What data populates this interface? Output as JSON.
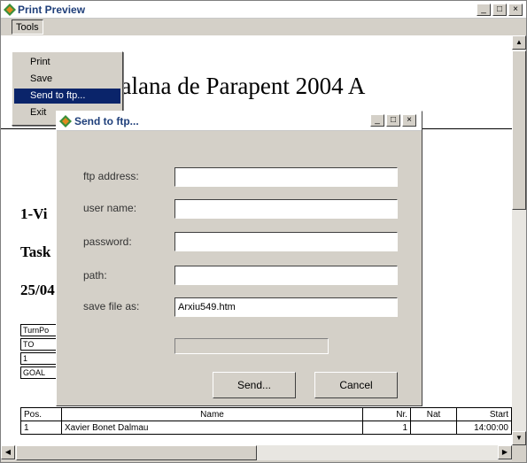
{
  "window": {
    "title": "Print Preview"
  },
  "menubar": {
    "tools_label": "Tools"
  },
  "tools_menu": {
    "items": [
      "Print",
      "Save",
      "Send to ftp...",
      "Exit"
    ],
    "selected": "Send to ftp..."
  },
  "page": {
    "title": "talana de Parapent 2004 A",
    "headings": [
      "1-Vi",
      "Task",
      "25/04"
    ],
    "boxes": [
      "TurnPo",
      "TO",
      "1",
      "GOAL"
    ],
    "results": {
      "columns": [
        "Pos.",
        "Name",
        "Nr.",
        "Nat",
        "Start"
      ],
      "rows": [
        [
          "1",
          "Xavier Bonet Dalmau",
          "1",
          "",
          "14:00:00"
        ]
      ]
    }
  },
  "dialog": {
    "title": "Send to ftp...",
    "fields": {
      "ftp_address": {
        "label": "ftp address:",
        "value": ""
      },
      "user_name": {
        "label": "user name:",
        "value": ""
      },
      "password": {
        "label": "password:",
        "value": ""
      },
      "path": {
        "label": "path:",
        "value": ""
      },
      "save_file_as": {
        "label": "save file as:",
        "value": "Arxiu549.htm"
      }
    },
    "progress": 0,
    "send_label": "Send...",
    "cancel_label": "Cancel"
  },
  "colors": {
    "selection": "#0a246a",
    "chrome": "#d4d0c8",
    "title_text": "#1f3f7a"
  },
  "icons": [
    "app-icon",
    "minimize-icon",
    "maximize-icon",
    "close-icon",
    "arrow-up-icon",
    "arrow-down-icon",
    "arrow-left-icon",
    "arrow-right-icon"
  ]
}
